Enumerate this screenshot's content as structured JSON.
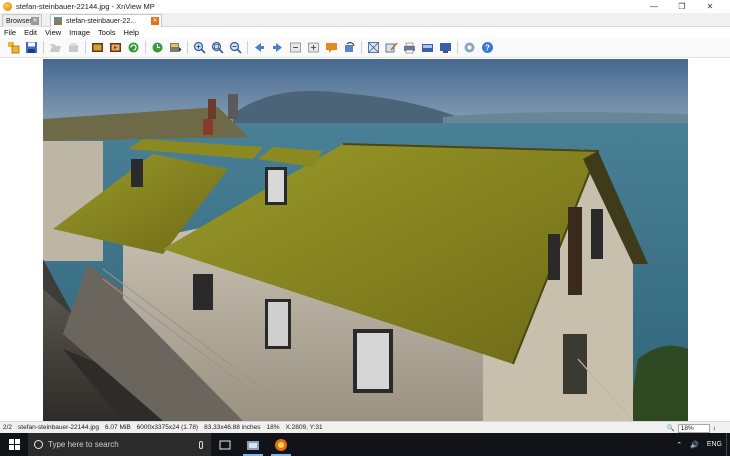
{
  "window": {
    "title": "stefan-steinbauer-22144.jpg - XnView MP",
    "controls": [
      "minimize-icon",
      "restore-icon",
      "close-icon"
    ]
  },
  "tabs": [
    {
      "label": "Browser",
      "icon": "close-icon"
    },
    {
      "label": "stefan-steinbauer-22...",
      "icon": "close-icon"
    }
  ],
  "menu": [
    "File",
    "Edit",
    "View",
    "Image",
    "Tools",
    "Help"
  ],
  "toolbar": {
    "buttons": [
      "browser-icon",
      "save-icon",
      "open-icon",
      "print-preview-icon",
      "fullscreen-icon",
      "slideshow-icon",
      "refresh-icon",
      "rotate-icon",
      "export-icon",
      "zoom-in-icon",
      "zoom-fit-icon",
      "zoom-out-icon",
      "previous-icon",
      "next-icon",
      "first-icon",
      "last-icon",
      "comment-icon",
      "rotate-left-icon",
      "crop-icon",
      "edit-icon",
      "print-icon",
      "scan-icon",
      "desktop-icon",
      "settings-icon",
      "help-icon"
    ]
  },
  "status": {
    "index": "2/2",
    "filename": "stefan-steinbauer-22144.jpg",
    "size": "6.07 MiB",
    "dimensions": "6000x3375x24 (1.78)",
    "print_size": "83.33x46.88 inches",
    "zoom_percent": "18%",
    "coords": "X:2809, Y:31",
    "zoom_value": "18%"
  },
  "taskbar": {
    "search_placeholder": "Type here to search",
    "language": "ENG",
    "apps": [
      "task-view-icon",
      "explorer-icon",
      "xnview-icon"
    ]
  },
  "colors": {
    "accent": "#e2701a",
    "taskbar": "#111318",
    "roof": "#8a8a1e",
    "sky": "#4e6f93",
    "sea": "#3b6f86"
  }
}
